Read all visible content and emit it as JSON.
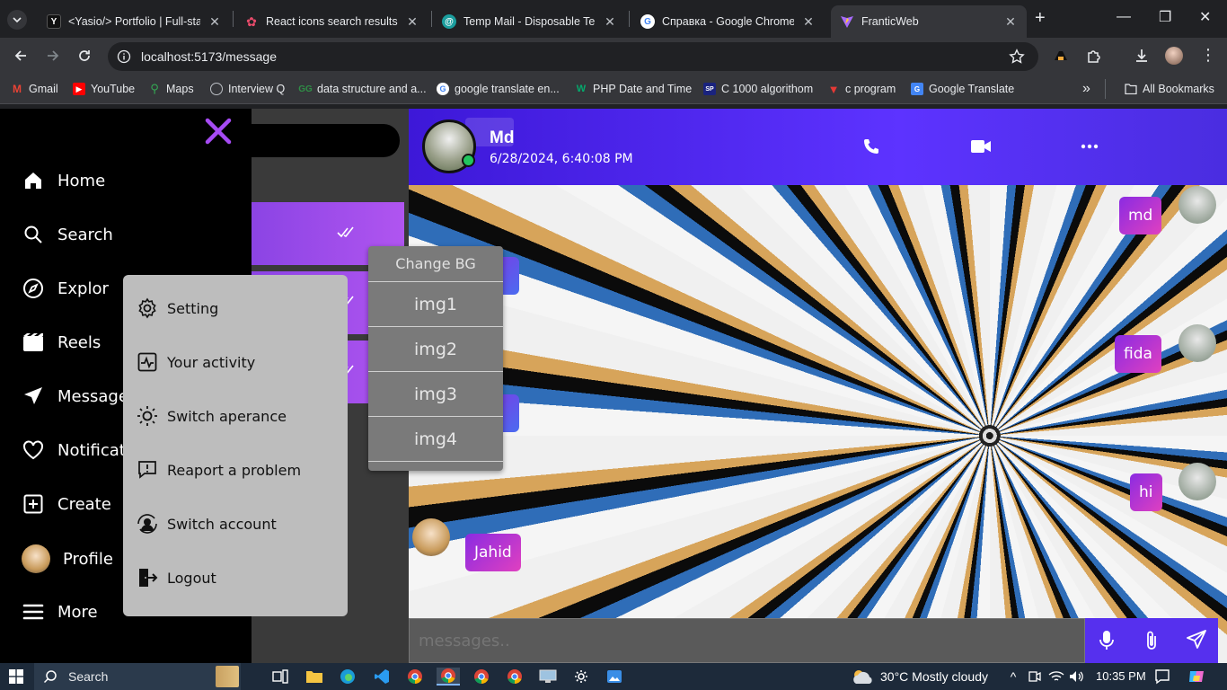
{
  "browser": {
    "tabs": [
      {
        "title": "<Yasio/> Portfolio | Full-stac",
        "favicon": "portfolio-favicon",
        "active": false
      },
      {
        "title": "React icons search results",
        "favicon": "react-icons-favicon",
        "active": false
      },
      {
        "title": "Temp Mail - Disposable Tem",
        "favicon": "tempmail-favicon",
        "active": false
      },
      {
        "title": "Справка - Google Chrome",
        "favicon": "google-favicon",
        "active": false
      },
      {
        "title": "FranticWeb",
        "favicon": "vite-favicon",
        "active": true
      }
    ],
    "url": "localhost:5173/message",
    "bookmarks": [
      {
        "label": "Gmail",
        "icon": "gmail-icon",
        "color": "#ea4335"
      },
      {
        "label": "YouTube",
        "icon": "youtube-icon",
        "color": "#ff0000"
      },
      {
        "label": "Maps",
        "icon": "maps-icon",
        "color": "#34a853"
      },
      {
        "label": "Interview Q",
        "icon": "globe-icon",
        "color": "#9aa0a6"
      },
      {
        "label": "data structure and a...",
        "icon": "gfg-icon",
        "color": "#2f8d46"
      },
      {
        "label": "google translate en...",
        "icon": "google-icon",
        "color": "#4285f4"
      },
      {
        "label": "PHP Date and Time",
        "icon": "w3schools-icon",
        "color": "#04aa6d"
      },
      {
        "label": "C 1000  algorithom",
        "icon": "bookmark-site-icon",
        "color": "#1a237e"
      },
      {
        "label": "c program",
        "icon": "vivaldi-icon",
        "color": "#d32f2f"
      },
      {
        "label": "Google Translate",
        "icon": "translate-icon",
        "color": "#4285f4"
      }
    ],
    "all_bookmarks_label": "All Bookmarks"
  },
  "sidebar": {
    "items": [
      {
        "label": "Home",
        "icon": "home-icon"
      },
      {
        "label": "Search",
        "icon": "search-icon"
      },
      {
        "label": "Explor",
        "icon": "compass-icon"
      },
      {
        "label": "Reels",
        "icon": "reels-icon"
      },
      {
        "label": "Message",
        "icon": "send-icon"
      },
      {
        "label": "Notificati",
        "icon": "heart-icon"
      },
      {
        "label": "Create",
        "icon": "plus-square-icon"
      },
      {
        "label": "Profile",
        "icon": "profile-avatar"
      },
      {
        "label": "More",
        "icon": "menu-icon"
      }
    ]
  },
  "more_menu": {
    "items": [
      {
        "label": "Setting",
        "icon": "gear-icon"
      },
      {
        "label": "Your activity",
        "icon": "activity-icon"
      },
      {
        "label": "Switch aperance",
        "icon": "sun-icon"
      },
      {
        "label": "Reaport a problem",
        "icon": "report-icon"
      },
      {
        "label": "Switch account",
        "icon": "switch-account-icon"
      },
      {
        "label": "Logout",
        "icon": "logout-icon"
      }
    ]
  },
  "bg_menu": {
    "title": "Change BG",
    "options": [
      "img1",
      "img2",
      "img3",
      "img4"
    ]
  },
  "chat": {
    "contact_name": "Md",
    "last_seen": "6/28/2024, 6:40:08 PM",
    "online": true,
    "messages": [
      {
        "text": "md",
        "side": "right"
      },
      {
        "text": "fida",
        "side": "right"
      },
      {
        "text": "hi",
        "side": "right"
      },
      {
        "text": "Jahid",
        "side": "left"
      }
    ],
    "input_placeholder": "messages.."
  },
  "colors": {
    "accent_purple": "#5630ee",
    "bubble_gradient_start": "#8a2be2",
    "bubble_gradient_end": "#e040c0",
    "close_x": "#a64bf4",
    "online_dot": "#22c55e"
  },
  "taskbar": {
    "search_label": "Search",
    "weather": "30°C  Mostly cloudy",
    "time": "10:35 PM"
  }
}
